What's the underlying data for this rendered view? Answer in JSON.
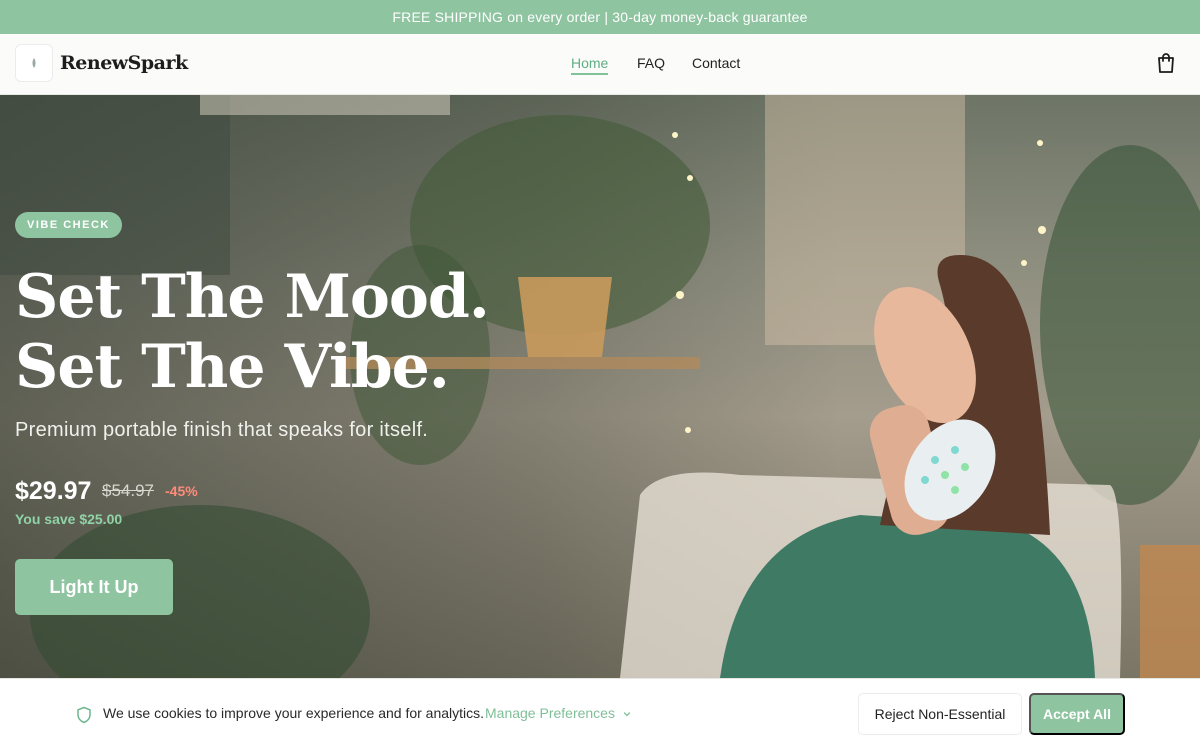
{
  "announcement": "FREE SHIPPING on every order | 30-day money-back guarantee",
  "brand": {
    "name": "RenewSpark"
  },
  "nav": {
    "home": "Home",
    "faq": "FAQ",
    "contact": "Contact"
  },
  "hero": {
    "badge": "VIBE CHECK",
    "headline_line1": "Set The Mood.",
    "headline_line2": "Set The Vibe.",
    "subtitle": "Premium portable finish that speaks for itself.",
    "price": "$29.97",
    "compare_price": "$54.97",
    "discount": "-45%",
    "savings": "You save $25.00",
    "cta": "Light It Up"
  },
  "cookie": {
    "message": "We use cookies to improve your experience and for analytics.",
    "manage": "Manage Preferences",
    "reject": "Reject Non-Essential",
    "accept": "Accept All"
  },
  "colors": {
    "accent": "#8fc4a1",
    "announcement_bg": "#8fc4a1",
    "discount": "#ff8b7a",
    "savings": "#8fd3a6"
  },
  "icons": [
    "leaf-logo-icon",
    "cart-icon",
    "shield-icon",
    "chevron-down-icon"
  ]
}
